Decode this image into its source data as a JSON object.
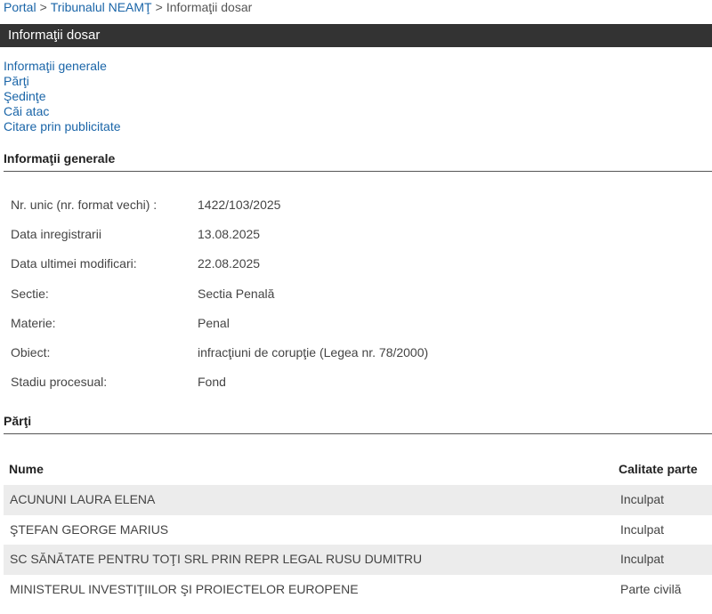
{
  "breadcrumb": {
    "items": [
      "Portal",
      "Tribunalul NEAMŢ",
      "Informaţii dosar"
    ],
    "separator": ">"
  },
  "page_title": "Informaţii dosar",
  "section_nav": [
    "Informaţii generale",
    "Părţi",
    "Şedinţe",
    "Căi atac",
    "Citare prin publicitate"
  ],
  "general": {
    "header": "Informaţii generale",
    "rows": [
      {
        "label": "Nr. unic (nr. format vechi) :",
        "value": "1422/103/2025"
      },
      {
        "label": "Data inregistrarii",
        "value": "13.08.2025"
      },
      {
        "label": "Data ultimei modificari:",
        "value": "22.08.2025"
      },
      {
        "label": "Sectie:",
        "value": "Sectia Penală"
      },
      {
        "label": "Materie:",
        "value": "Penal"
      },
      {
        "label": "Obiect:",
        "value": "infracţiuni de corupţie (Legea nr. 78/2000)"
      },
      {
        "label": "Stadiu procesual:",
        "value": "Fond"
      }
    ]
  },
  "parti": {
    "header": "Părţi",
    "columns": [
      "Nume",
      "Calitate parte"
    ],
    "rows": [
      {
        "name": "ACUNUNI LAURA ELENA",
        "role": "Inculpat"
      },
      {
        "name": "ŞTEFAN GEORGE MARIUS",
        "role": "Inculpat"
      },
      {
        "name": "SC SĂNĂTATE PENTRU TOŢI SRL PRIN REPR LEGAL RUSU DUMITRU",
        "role": "Inculpat"
      },
      {
        "name": "MINISTERUL INVESTIŢIILOR ŞI PROIECTELOR EUROPENE",
        "role": "Parte civilă"
      }
    ]
  },
  "colors": {
    "link": "#1a65a8",
    "title_bar_bg": "#333333",
    "row_alt_bg": "#ececec"
  }
}
